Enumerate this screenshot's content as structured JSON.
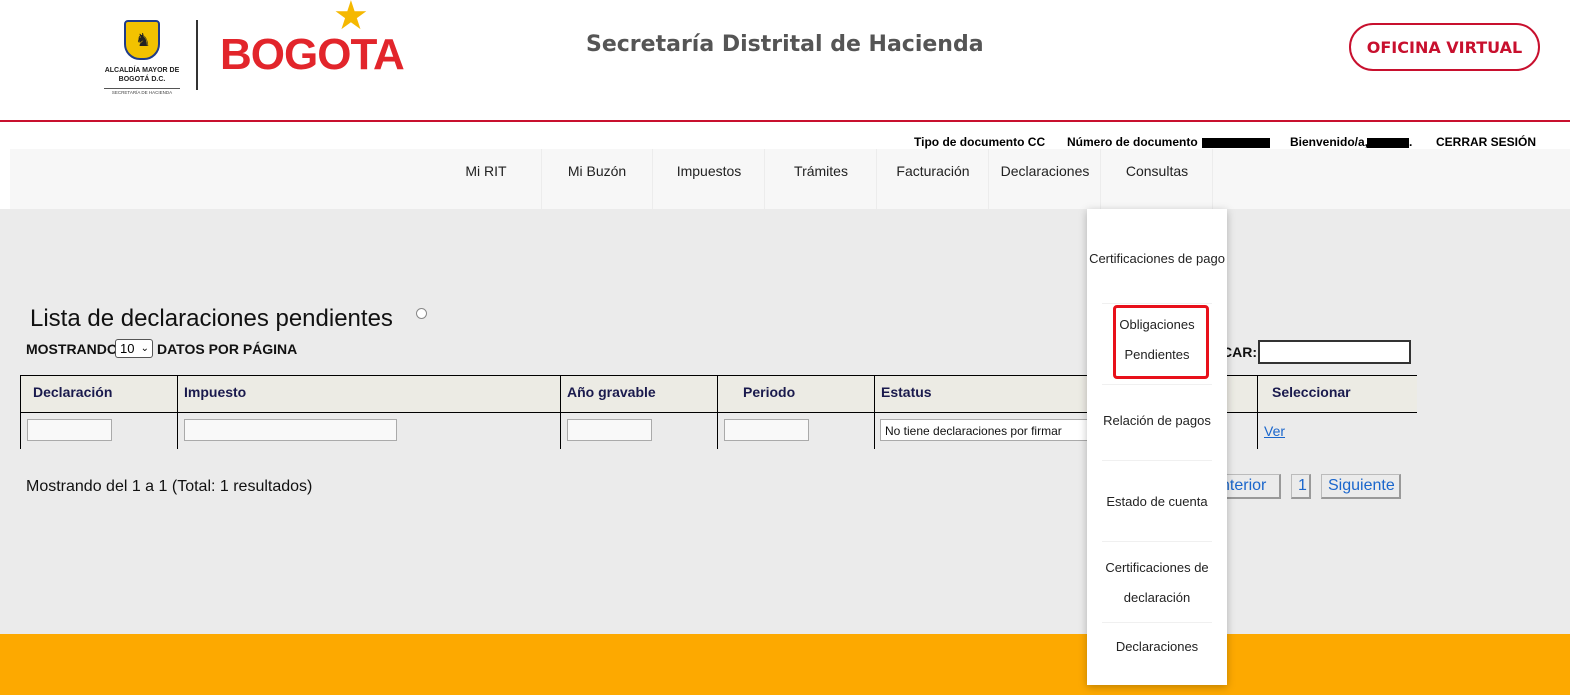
{
  "header": {
    "seal_text": "ALCALDÍA MAYOR DE BOGOTÁ D.C.",
    "seal_sub": "SECRETARÍA DE HACIENDA",
    "brand": "BOGOTA",
    "title": "Secretaría Distrital de Hacienda",
    "oficina_button": "OFICINA VIRTUAL"
  },
  "infobar": {
    "doc_type": "Tipo de documento CC",
    "doc_number_label": "Número de documento",
    "welcome": "Bienvenido/a,",
    "welcome_suffix": ".",
    "logout": "CERRAR SESIÓN"
  },
  "nav": {
    "items": [
      "Mi RIT",
      "Mi Buzón",
      "Impuestos",
      "Trámites",
      "Facturación",
      "Declaraciones",
      "Consultas"
    ]
  },
  "content": {
    "title": "Lista de declaraciones pendientes",
    "showing_label": "MOSTRANDO",
    "page_size": "10",
    "per_page_label": "DATOS POR PÁGINA",
    "search_label": "BUSCAR:",
    "search_label_visible": "CAR:",
    "search_value": "",
    "columns": [
      "Declaración",
      "Impuesto",
      "Año gravable",
      "Periodo",
      "Estatus",
      "",
      "Seleccionar"
    ],
    "row": {
      "status": "No tiene declaraciones por firmar",
      "action": "Ver"
    },
    "summary": "Mostrando del 1 a 1 (Total: 1 resultados)",
    "pager": {
      "prev": "nterior",
      "page": "1",
      "next": "Siguiente"
    }
  },
  "dropdown": {
    "items": [
      "Certificaciones de pago",
      "Obligaciones Pendientes",
      "Relación de pagos",
      "Estado de cuenta",
      "Certificaciones de declaración",
      "Declaraciones"
    ]
  },
  "colors": {
    "brand_red": "#c8102e",
    "footer_orange": "#fda900",
    "highlight": "#e8101a",
    "link": "#1a66cc"
  }
}
